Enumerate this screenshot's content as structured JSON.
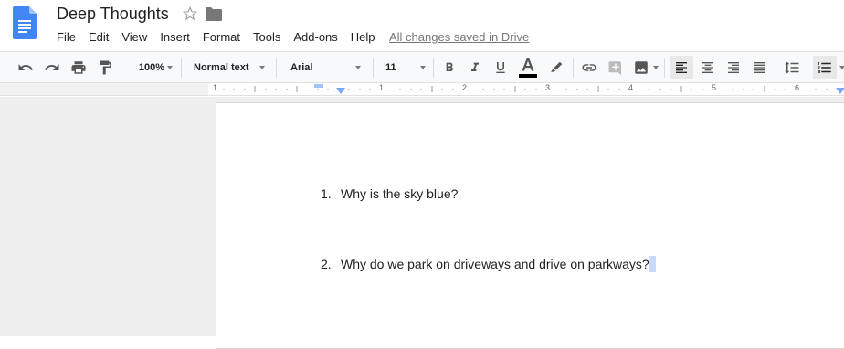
{
  "document": {
    "title": "Deep Thoughts"
  },
  "menu": [
    "File",
    "Edit",
    "View",
    "Insert",
    "Format",
    "Tools",
    "Add-ons",
    "Help"
  ],
  "save_status": "All changes saved in Drive",
  "toolbar": {
    "zoom": "100%",
    "style": "Normal text",
    "font": "Arial",
    "font_size": "11"
  },
  "ruler_numbers": [
    "1",
    "1",
    "2",
    "3",
    "4",
    "5",
    "6"
  ],
  "content": {
    "list": [
      {
        "number": "1.",
        "text": "Why is the sky blue?"
      },
      {
        "number": "2.",
        "text": "Why do we park on driveways and drive on parkways?"
      }
    ]
  },
  "colors": {
    "accent": "#4285f4",
    "text": "#202124",
    "selection": "#c6dafc"
  }
}
